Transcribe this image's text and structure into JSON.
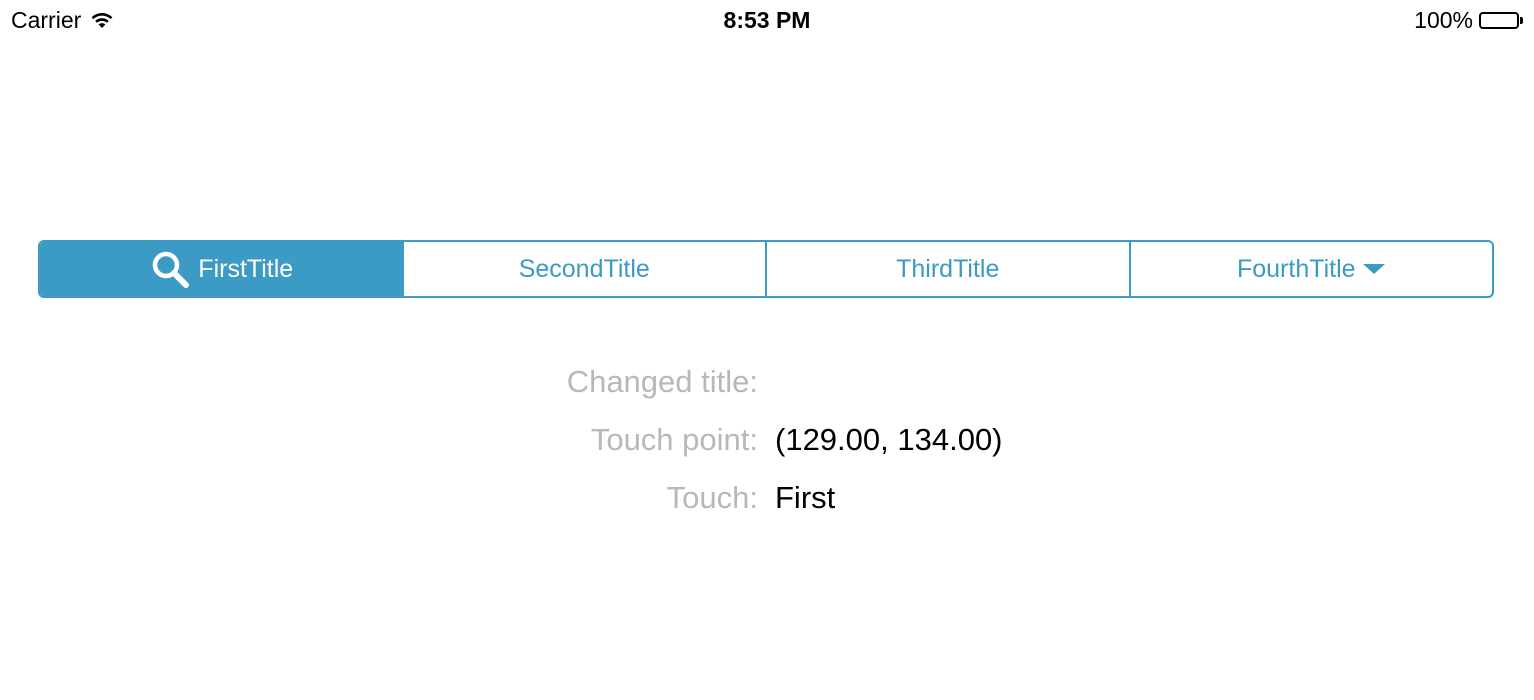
{
  "status_bar": {
    "carrier": "Carrier",
    "time": "8:53 PM",
    "battery_percent": "100%",
    "battery_level": 1.0,
    "wifi_icon": "wifi-icon",
    "battery_icon": "battery-icon"
  },
  "segmented_control": {
    "selected_index": 0,
    "accent_color": "#3c9bc4",
    "segments": [
      {
        "label": "FirstTitle",
        "icon": "search-icon"
      },
      {
        "label": "SecondTitle"
      },
      {
        "label": "ThirdTitle"
      },
      {
        "label": "FourthTitle",
        "icon": "triangle-down-icon"
      }
    ]
  },
  "info": {
    "changed_title_label": "Changed title:",
    "changed_title_value": "",
    "touch_point_label": "Touch point:",
    "touch_point_value": "(129.00, 134.00)",
    "touch_label": "Touch:",
    "touch_value": "First"
  },
  "colors": {
    "label_gray": "#b8b8b8",
    "value_black": "#000000"
  }
}
